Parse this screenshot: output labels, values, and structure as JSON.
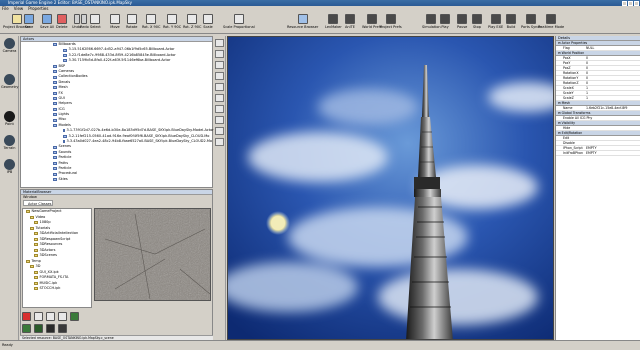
{
  "window": {
    "title": "Imperial Game Engine 2 Editor: BASE_OSTANKINO.ipk.MapSky"
  },
  "menu": [
    "File",
    "View",
    "Properties"
  ],
  "toolbar": [
    {
      "label": "Project Browser",
      "icon": "project-icon"
    },
    {
      "label": "Save",
      "icon": "save-icon"
    },
    {
      "label": "Save All",
      "icon": "save-all-icon"
    },
    {
      "label": "Delete",
      "icon": "delete-icon"
    },
    {
      "label": "Select",
      "icon": "select-icon"
    },
    {
      "label": "Move",
      "icon": "move-icon"
    },
    {
      "label": "Rotate",
      "icon": "rotate-icon"
    },
    {
      "label": "Rot. X 90C",
      "icon": "rot-x-icon"
    },
    {
      "label": "Rot. Y 90C",
      "icon": "rot-y-icon"
    },
    {
      "label": "Rot. Z 90C",
      "icon": "rot-z-icon"
    },
    {
      "label": "Scale",
      "icon": "scale-icon"
    },
    {
      "label": "Scale Proportional",
      "icon": "scale-prop-icon"
    },
    {
      "label": "Resource Browser",
      "icon": "resource-icon"
    },
    {
      "label": "LevMaker",
      "icon": "levmaker-icon"
    },
    {
      "label": "AniTE",
      "icon": "anite-icon"
    },
    {
      "label": "World Prefs",
      "icon": "world-icon"
    },
    {
      "label": "Project Prefs",
      "icon": "prefs-icon"
    },
    {
      "label": "Simulation",
      "icon": "sim-icon"
    },
    {
      "label": "Play",
      "icon": "play-icon"
    },
    {
      "label": "Pause",
      "icon": "pause-icon"
    },
    {
      "label": "Stop",
      "icon": "stop-icon"
    },
    {
      "label": "Play EXE",
      "icon": "play-exe-icon"
    },
    {
      "label": "Build",
      "icon": "build-icon"
    },
    {
      "label": "Ports Synch",
      "icon": "ports-icon"
    },
    {
      "label": "Realtime Mode",
      "icon": "realtime-icon"
    }
  ],
  "toolbar_extra": {
    "undo": "Undo",
    "redo": "Redo"
  },
  "left_strip": [
    {
      "label": "Camera",
      "icon": "camera-icon"
    },
    {
      "label": "Geometry",
      "icon": "geometry-icon"
    },
    {
      "label": "Point",
      "icon": "point-icon"
    },
    {
      "label": "Terrain",
      "icon": "terrain-icon"
    },
    {
      "label": "IPB",
      "icon": "ipb-icon"
    }
  ],
  "actors_panel": {
    "title": "Actors",
    "items": [
      "Billboards",
      "3.15.5162E66.6697-4d52-a947-06b1f9d5c65.Billboard.Actor",
      "3.22.f1de8e7c-9988-433d-8f59-4216b85845e.Billboard.Actor",
      "3.30.7159b5d-8fa0-422f-a63f-5f1146ef6ba.Billboard.Actor",
      "BSP",
      "Cameras",
      "CollectionBodies",
      "Decals",
      "Mesh",
      "FX",
      "GUI",
      "Helpers",
      "ICG",
      "Lights",
      "Misc",
      "Models",
      "3.1.7391f2d7-027b-4e6d-b30e-8a183d95d7d.BASE_SKY.ipk.BlueDaySky.Model.Actor",
      "3.2.11fef215-0560-41ad-916e-9eaf0f4f5f6.BASE_SKY.ipk.BlueDaySky_CLOUD.Mo",
      "3.3.43a0d027-4ea2-48c2-94b8-fbae6527a0.BASE_SKY.ipk.BlueDaySky_CLOUD2.Mo",
      "Scenes",
      "Sounds",
      "Particle",
      "Paths",
      "Particle",
      "Procedural",
      "Skies"
    ]
  },
  "material_browser": {
    "title": "MaterialBrowser",
    "window_label": "Window",
    "tab": "Actor Classes",
    "folders": [
      "NewGameProject",
      "Video",
      "1080p",
      "Tutorials",
      "3DArtificialIntellection",
      "3DRespawnScript",
      "3DResources",
      "3DActors",
      "3DScenes",
      "Temp",
      "3D",
      "GUI_XX.ipk",
      "FORMATA_FS.ITA",
      "MUSIC.ipk",
      "STOCCH.ipk"
    ],
    "selected_resource": "Selected resource: BASE_OSTANKINO.ipk.MapSky.c_scene"
  },
  "details_panel": {
    "title": "Details",
    "sections": [
      {
        "name": "Actor Properties",
        "rows": [
          {
            "k": "Flag",
            "v": "NULL"
          }
        ]
      },
      {
        "name": "World Position",
        "rows": [
          {
            "k": "PosX",
            "v": "0"
          },
          {
            "k": "PosY",
            "v": "0"
          },
          {
            "k": "PosZ",
            "v": "0"
          },
          {
            "k": "RotationX",
            "v": "0"
          },
          {
            "k": "RotationY",
            "v": "0"
          },
          {
            "k": "RotationZ",
            "v": "0"
          },
          {
            "k": "ScaleX",
            "v": "1"
          },
          {
            "k": "ScaleY",
            "v": "1"
          },
          {
            "k": "ScaleZ",
            "v": "1"
          }
        ]
      },
      {
        "name": "Mesh",
        "rows": [
          {
            "k": "Name",
            "v": "1.6eb2f21c-15e8-4ecf-8f9"
          }
        ]
      },
      {
        "name": "Global Transforms",
        "rows": [
          {
            "k": "Enable All ICG Phy",
            "v": ""
          }
        ]
      },
      {
        "name": "Visibility",
        "rows": [
          {
            "k": "Hide",
            "v": ""
          }
        ]
      },
      {
        "name": "Edit/Rotation",
        "rows": [
          {
            "k": "Edit",
            "v": ""
          },
          {
            "k": "Disable",
            "v": ""
          },
          {
            "k": "IPhon_Script",
            "v": "EMPTY"
          },
          {
            "k": "InitFroBPhon",
            "v": "EMPTY"
          }
        ]
      }
    ]
  },
  "status": {
    "text": "Ready"
  },
  "colors": {
    "title_bar": "#2a5a95",
    "sky_deep": "#0d2a72",
    "panel_bg": "#d4d0c8",
    "header_bg": "#c9d5e6"
  }
}
